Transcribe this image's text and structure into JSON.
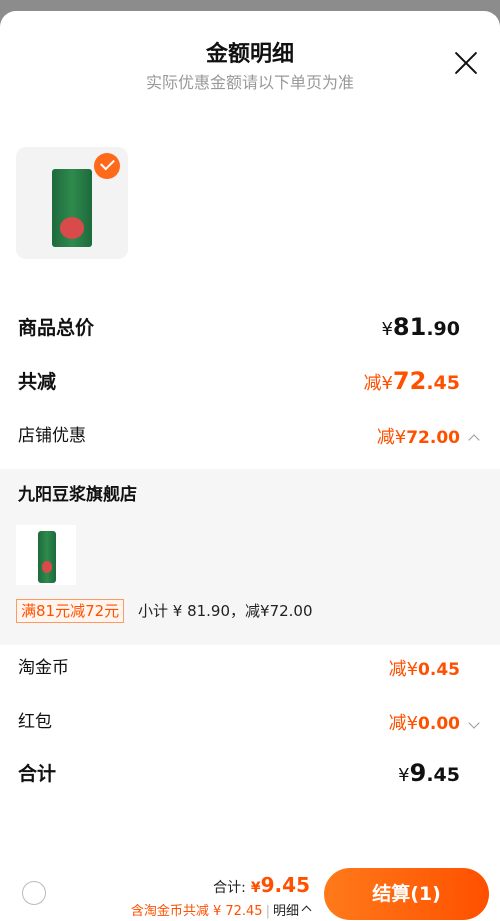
{
  "header": {
    "title": "金额明细",
    "subtitle": "实际优惠金额请以下单页为准"
  },
  "summary": {
    "goods_total": {
      "label": "商品总价",
      "currency": "¥",
      "int": "81",
      "dec": ".90"
    },
    "total_discount": {
      "label": "共减",
      "prefix": "减¥",
      "int": "72",
      "dec": ".45"
    },
    "shop_discount": {
      "label": "店铺优惠",
      "prefix": "减¥",
      "int": "72",
      "dec": ".00"
    }
  },
  "store": {
    "name": "九阳豆浆旗舰店",
    "promo_tag": "满81元减72元",
    "subtotal": "小计 ¥ 81.90，减¥72.00"
  },
  "others": {
    "coins": {
      "label": "淘金币",
      "prefix": "减¥",
      "int": "0",
      "dec": ".45"
    },
    "red_packet": {
      "label": "红包",
      "prefix": "减¥",
      "int": "0",
      "dec": ".00"
    },
    "total": {
      "label": "合计",
      "currency": "¥",
      "int": "9",
      "dec": ".45"
    }
  },
  "bottom_bar": {
    "total_label": "合计:",
    "total_currency": "¥",
    "total_value": "9.45",
    "coins_note": "含淘金币共减 ¥ 72.45",
    "separator": "|",
    "detail_label": "明细",
    "checkout_label": "结算(1)"
  },
  "colors": {
    "accent": "#ff5000",
    "muted": "#999999",
    "panel": "#f6f6f6"
  },
  "icons": [
    "close-icon",
    "checkmark-icon",
    "chevron-up-icon",
    "chevron-down-icon",
    "radio-icon"
  ]
}
